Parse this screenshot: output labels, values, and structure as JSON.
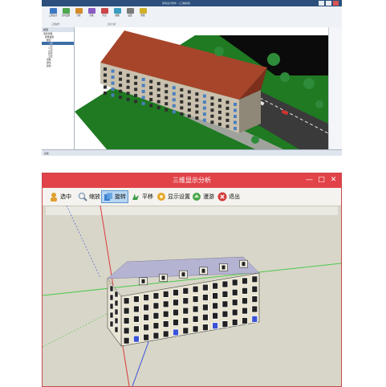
{
  "top_app": {
    "title": "建筑设计软件 - [三维模型]",
    "ribbon": {
      "buttons": [
        {
          "label": "三维设计",
          "color": "#3c78c4"
        },
        {
          "label": "实时漫游",
          "color": "#4ea64e"
        },
        {
          "label": "分析",
          "color": "#d28b2b"
        },
        {
          "label": "渲染",
          "color": "#8a5cc2"
        },
        {
          "label": "导出",
          "color": "#c9474a"
        },
        {
          "label": "视图",
          "color": "#3c9cbf"
        },
        {
          "label": "设置",
          "color": "#7a7a7a"
        },
        {
          "label": "帮助",
          "color": "#d1b02a"
        }
      ],
      "groups": [
        "三维操作",
        "显示分析"
      ]
    },
    "tree": {
      "header": "模型",
      "items": [
        "项目管理",
        "建筑模型",
        "楼层",
        "一层",
        "二层",
        "三层",
        "四层",
        "五层",
        "道路",
        "绿化",
        "其他"
      ],
      "selected_index": 3
    },
    "status_text": "就绪"
  },
  "window": {
    "title": "三维显示分析",
    "controls": {
      "minimize": "—",
      "maximize": "□",
      "close": "✕"
    },
    "toolbar": [
      {
        "icon": "select-icon",
        "label": "选中",
        "color": "#e0a030"
      },
      {
        "icon": "zoom-icon",
        "label": "缩放",
        "color": "#8da4c0"
      },
      {
        "icon": "rotate-icon",
        "label": "旋转",
        "color": "#3b7fcf",
        "active": true
      },
      {
        "icon": "pan-icon",
        "label": "平移",
        "color": "#3b9c4a"
      },
      {
        "icon": "display-settings-icon",
        "label": "显示设置",
        "color": "#e6a62a"
      },
      {
        "icon": "roam-icon",
        "label": "漫游",
        "color": "#4aa64a"
      },
      {
        "icon": "exit-icon",
        "label": "退出",
        "color": "#d33b3b"
      }
    ],
    "colors": {
      "titlebar": "#e14348",
      "background": "#d8d6c8",
      "roof": "#b5b3d2",
      "axis_red": "#d63a3a",
      "axis_green": "#4cc94c",
      "axis_blue": "#3a52d6"
    }
  }
}
